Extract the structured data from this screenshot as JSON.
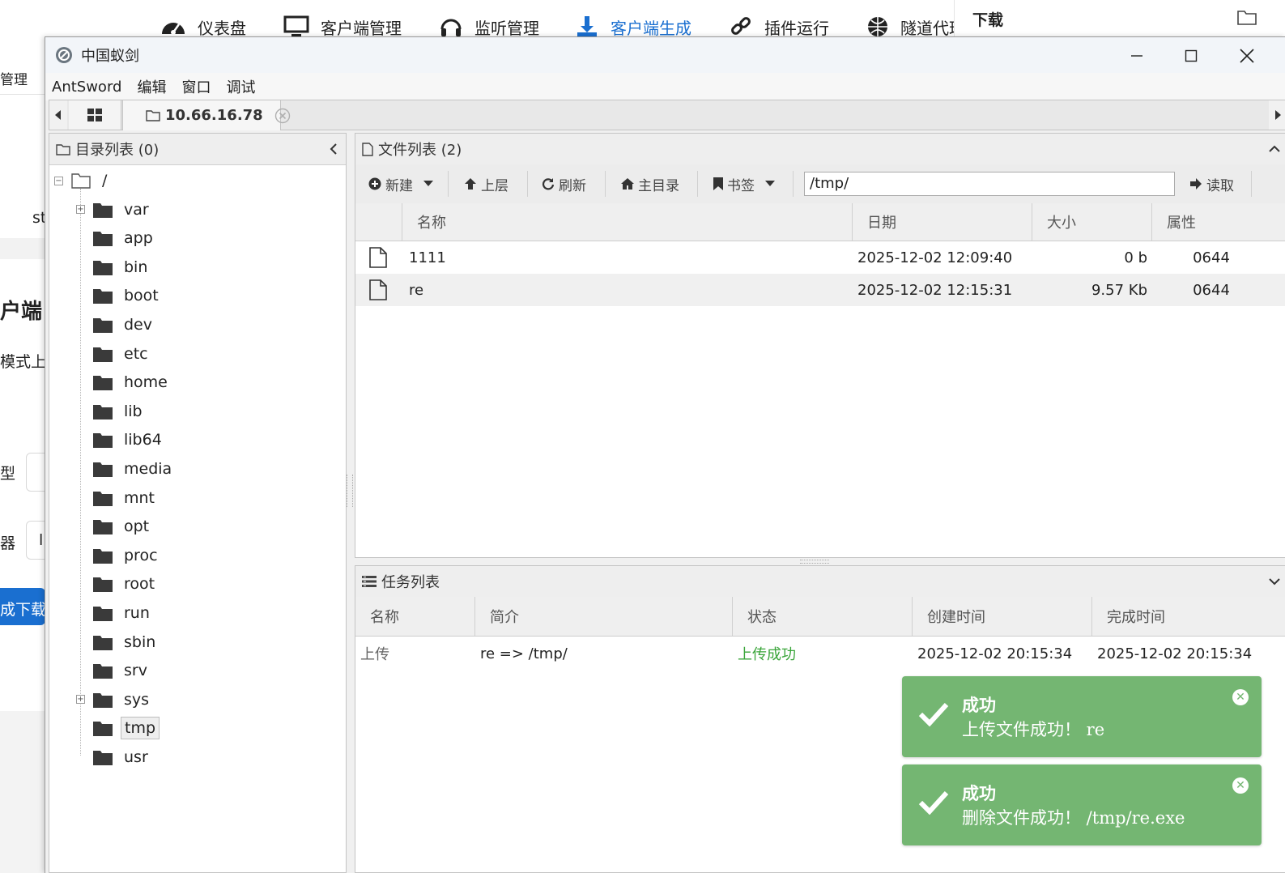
{
  "bg_nav": {
    "items": [
      {
        "label": "仪表盘",
        "icon": "dashboard-icon"
      },
      {
        "label": "客户端管理",
        "icon": "monitor-icon"
      },
      {
        "label": "监听管理",
        "icon": "headphones-icon"
      },
      {
        "label": "客户端生成",
        "icon": "download-icon"
      },
      {
        "label": "插件运行",
        "icon": "plugin-link-icon"
      },
      {
        "label": "隧道代理",
        "icon": "globe-icon"
      }
    ],
    "download_panel_title": "下载"
  },
  "bg_left": {
    "t1": "管理",
    "t2": "st",
    "t3": "户端",
    "t4": "模式上",
    "t5": "型",
    "t6": "器",
    "t7": "l",
    "t8": "成下载"
  },
  "window": {
    "title": "中国蚁剑",
    "menu": [
      "AntSword",
      "编辑",
      "窗口",
      "调试"
    ],
    "tab_label": "10.66.16.78"
  },
  "dir_panel": {
    "title": "目录列表 (0)",
    "root": "/",
    "folders": [
      "var",
      "app",
      "bin",
      "boot",
      "dev",
      "etc",
      "home",
      "lib",
      "lib64",
      "media",
      "mnt",
      "opt",
      "proc",
      "root",
      "run",
      "sbin",
      "srv",
      "sys",
      "tmp",
      "usr"
    ],
    "expandable": [
      "var",
      "sys"
    ],
    "selected": "tmp"
  },
  "file_panel": {
    "title": "文件列表 (2)",
    "toolbar": {
      "new": "新建",
      "up": "上层",
      "refresh": "刷新",
      "home": "主目录",
      "bookmark": "书签",
      "read": "读取"
    },
    "path": "/tmp/",
    "columns": [
      "名称",
      "日期",
      "大小",
      "属性"
    ],
    "rows": [
      {
        "name": "1111",
        "date": "2025-12-02 12:09:40",
        "size": "0 b",
        "perm": "0644"
      },
      {
        "name": "re",
        "date": "2025-12-02 12:15:31",
        "size": "9.57 Kb",
        "perm": "0644"
      }
    ]
  },
  "task_panel": {
    "title": "任务列表",
    "columns": [
      "名称",
      "简介",
      "状态",
      "创建时间",
      "完成时间"
    ],
    "rows": [
      {
        "name": "上传",
        "desc": "re => /tmp/",
        "status": "上传成功",
        "created": "2025-12-02 20:15:34",
        "finished": "2025-12-02 20:15:34"
      }
    ]
  },
  "toasts": [
    {
      "title": "成功",
      "message": "上传文件成功！ re"
    },
    {
      "title": "成功",
      "message": "删除文件成功！ /tmp/re.exe"
    }
  ],
  "colors": {
    "accent": "#1a6fd0",
    "toast_bg": "#74b672",
    "status_success": "#3aa53a"
  }
}
